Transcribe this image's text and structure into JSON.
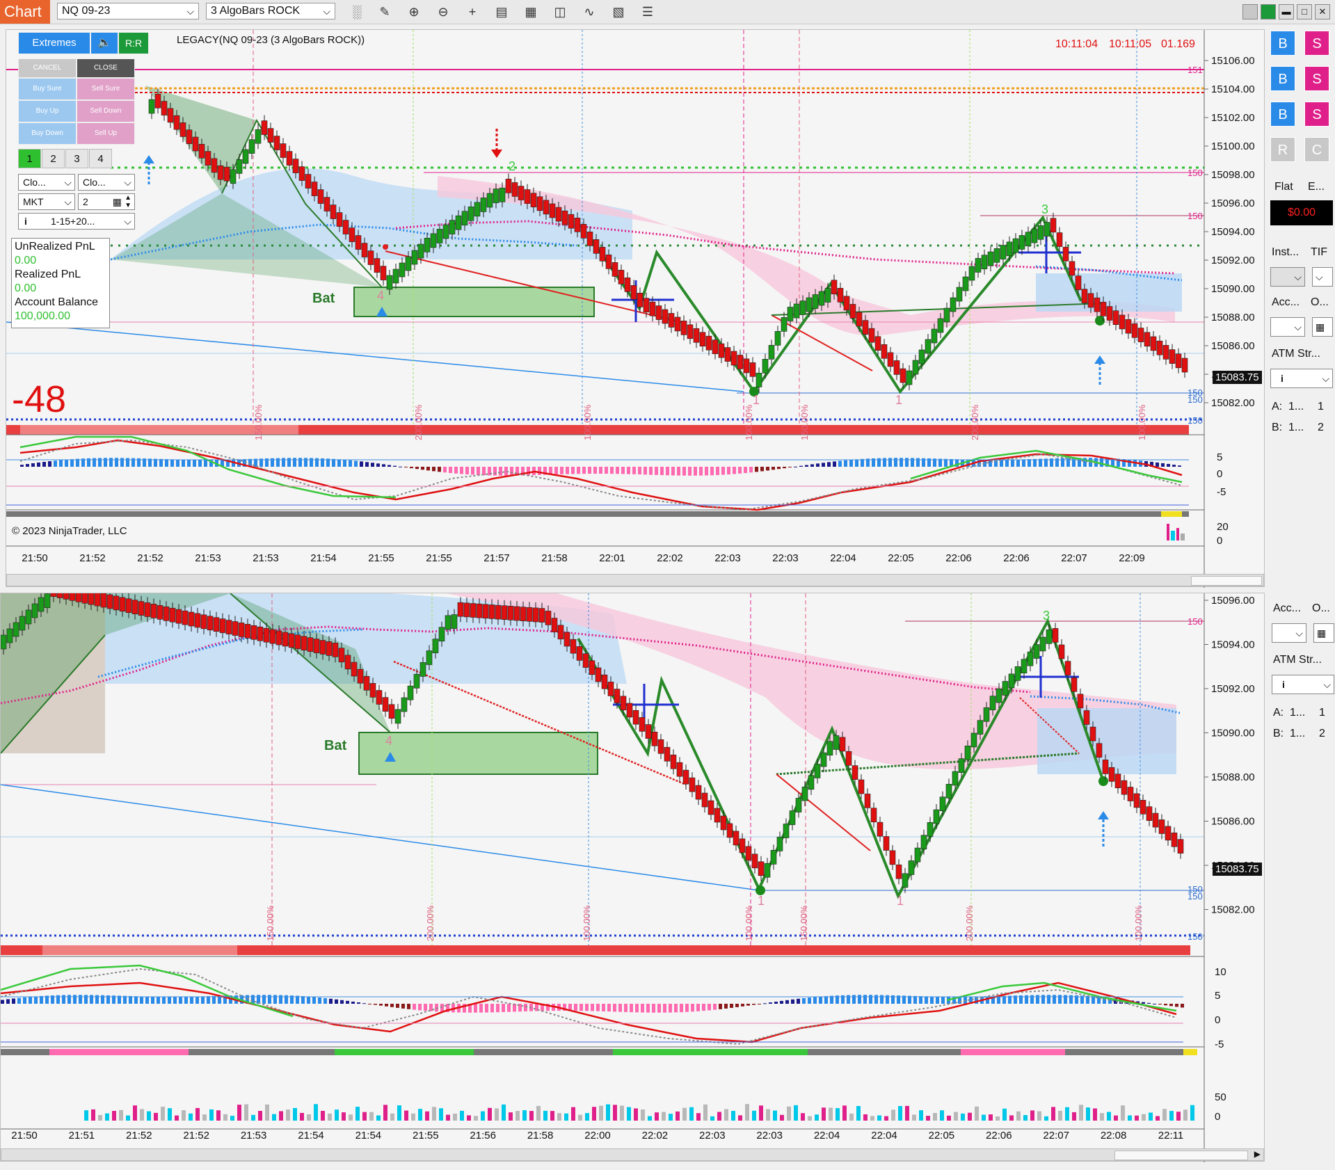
{
  "toolbar": {
    "tab_label": "Chart",
    "instrument": "NQ 09-23",
    "bar_type": "3 AlgoBars ROCK",
    "icons": [
      "bar-style-icon",
      "draw-tool-icon",
      "zoom-in-icon",
      "zoom-out-icon",
      "crosshair-icon",
      "data-box-icon",
      "strategies-icon",
      "indicators-icon",
      "templates-icon",
      "properties-icon",
      "list-icon"
    ]
  },
  "chart_trader": {
    "extremes_label": "Extremes",
    "rr_label": "R:R",
    "cancel_label": "CANCEL",
    "close_label": "CLOSE",
    "buy_sure": "Buy Sure",
    "sell_sure": "Sell Sure",
    "buy_up": "Buy Up",
    "sell_down": "Sell Down",
    "buy_down": "Buy Down",
    "sell_up": "Sell Up",
    "tabs": [
      "1",
      "2",
      "3",
      "4"
    ],
    "close_sel_1": "Clo...",
    "close_sel_2": "Clo...",
    "order_type": "MKT",
    "quantity": "2",
    "atm_sel": "1-15+20...",
    "unrealized_label": "UnRealized PnL",
    "unrealized_value": "0.00",
    "realized_label": "Realized PnL",
    "realized_value": "0.00",
    "balance_label": "Account Balance",
    "balance_value": "100,000.00"
  },
  "top_chart": {
    "title": "LEGACY(NQ 09-23 (3 AlgoBars ROCK))",
    "clock_1": "10:11:04",
    "clock_2": "10:11:05",
    "clock_3": "01.169",
    "big_number": "-48",
    "pattern_label": "Bat",
    "point_2": "2",
    "point_3": "3",
    "point_4": "4",
    "point_1a": "1",
    "point_1b": "1",
    "last_price": "15083.75",
    "copyright": "© 2023 NinjaTrader, LLC",
    "price_ticks": [
      "15106.00",
      "15104.00",
      "15102.00",
      "15100.00",
      "15098.00",
      "15096.00",
      "15094.00",
      "15092.00",
      "15090.00",
      "15088.00",
      "15086.00",
      "15084.00",
      "15082.00"
    ],
    "level_tags": [
      "151",
      "150",
      "150",
      "150",
      "150",
      "150"
    ],
    "osc_ticks": [
      "5",
      "0",
      "-5"
    ],
    "vol_ticks": [
      "20",
      "0"
    ],
    "time_labels": [
      "21:50",
      "21:52",
      "21:52",
      "21:53",
      "21:53",
      "21:54",
      "21:55",
      "21:55",
      "21:57",
      "21:58",
      "22:01",
      "22:02",
      "22:03",
      "22:03",
      "22:04",
      "22:05",
      "22:06",
      "22:06",
      "22:07",
      "22:09"
    ],
    "pct_labels": [
      "150.00%",
      "200.00%",
      "100.00%",
      "100.00%",
      "150.00%",
      "200.00%",
      "100.00%"
    ]
  },
  "bottom_chart": {
    "pattern_label": "Bat",
    "point_3": "3",
    "point_4": "4",
    "point_1a": "1",
    "point_1b": "1",
    "last_price": "15083.75",
    "price_ticks": [
      "15096.00",
      "15094.00",
      "15092.00",
      "15090.00",
      "15088.00",
      "15086.00",
      "15084.00",
      "15082.00"
    ],
    "level_tags": [
      "150",
      "150",
      "150",
      "150"
    ],
    "osc_ticks": [
      "10",
      "5",
      "0",
      "-5"
    ],
    "vol_ticks": [
      "50",
      "0"
    ],
    "time_labels": [
      "21:50",
      "21:51",
      "21:52",
      "21:52",
      "21:53",
      "21:54",
      "21:54",
      "21:55",
      "21:56",
      "21:58",
      "22:00",
      "22:02",
      "22:03",
      "22:03",
      "22:04",
      "22:04",
      "22:05",
      "22:06",
      "22:07",
      "22:08",
      "22:11"
    ],
    "pct_labels": [
      "150.00%",
      "200.00%",
      "100.00%",
      "100.00%",
      "150.00%",
      "200.00%",
      "100.00%"
    ]
  },
  "right_panel": {
    "buy_label": "B",
    "sell_label": "S",
    "reverse_label": "R",
    "close_label": "C",
    "position": "Flat",
    "entry_short": "E...",
    "pnl": "$0.00",
    "instrument_label": "Inst...",
    "tif_label": "TIF",
    "account_label": "Acc...",
    "o_label": "O...",
    "atm_label": "ATM Str...",
    "a_row": "A:",
    "a_val": "1...",
    "a_num": "1",
    "b_row": "B:",
    "b_val": "1...",
    "b_num": "2",
    "info_icon": "i"
  },
  "colors": {
    "up": "#1a9a1a",
    "down": "#e01010",
    "accent_blue": "#2a8ae8",
    "magenta": "#e0208a",
    "pattern_green": "#2a7a2a"
  }
}
